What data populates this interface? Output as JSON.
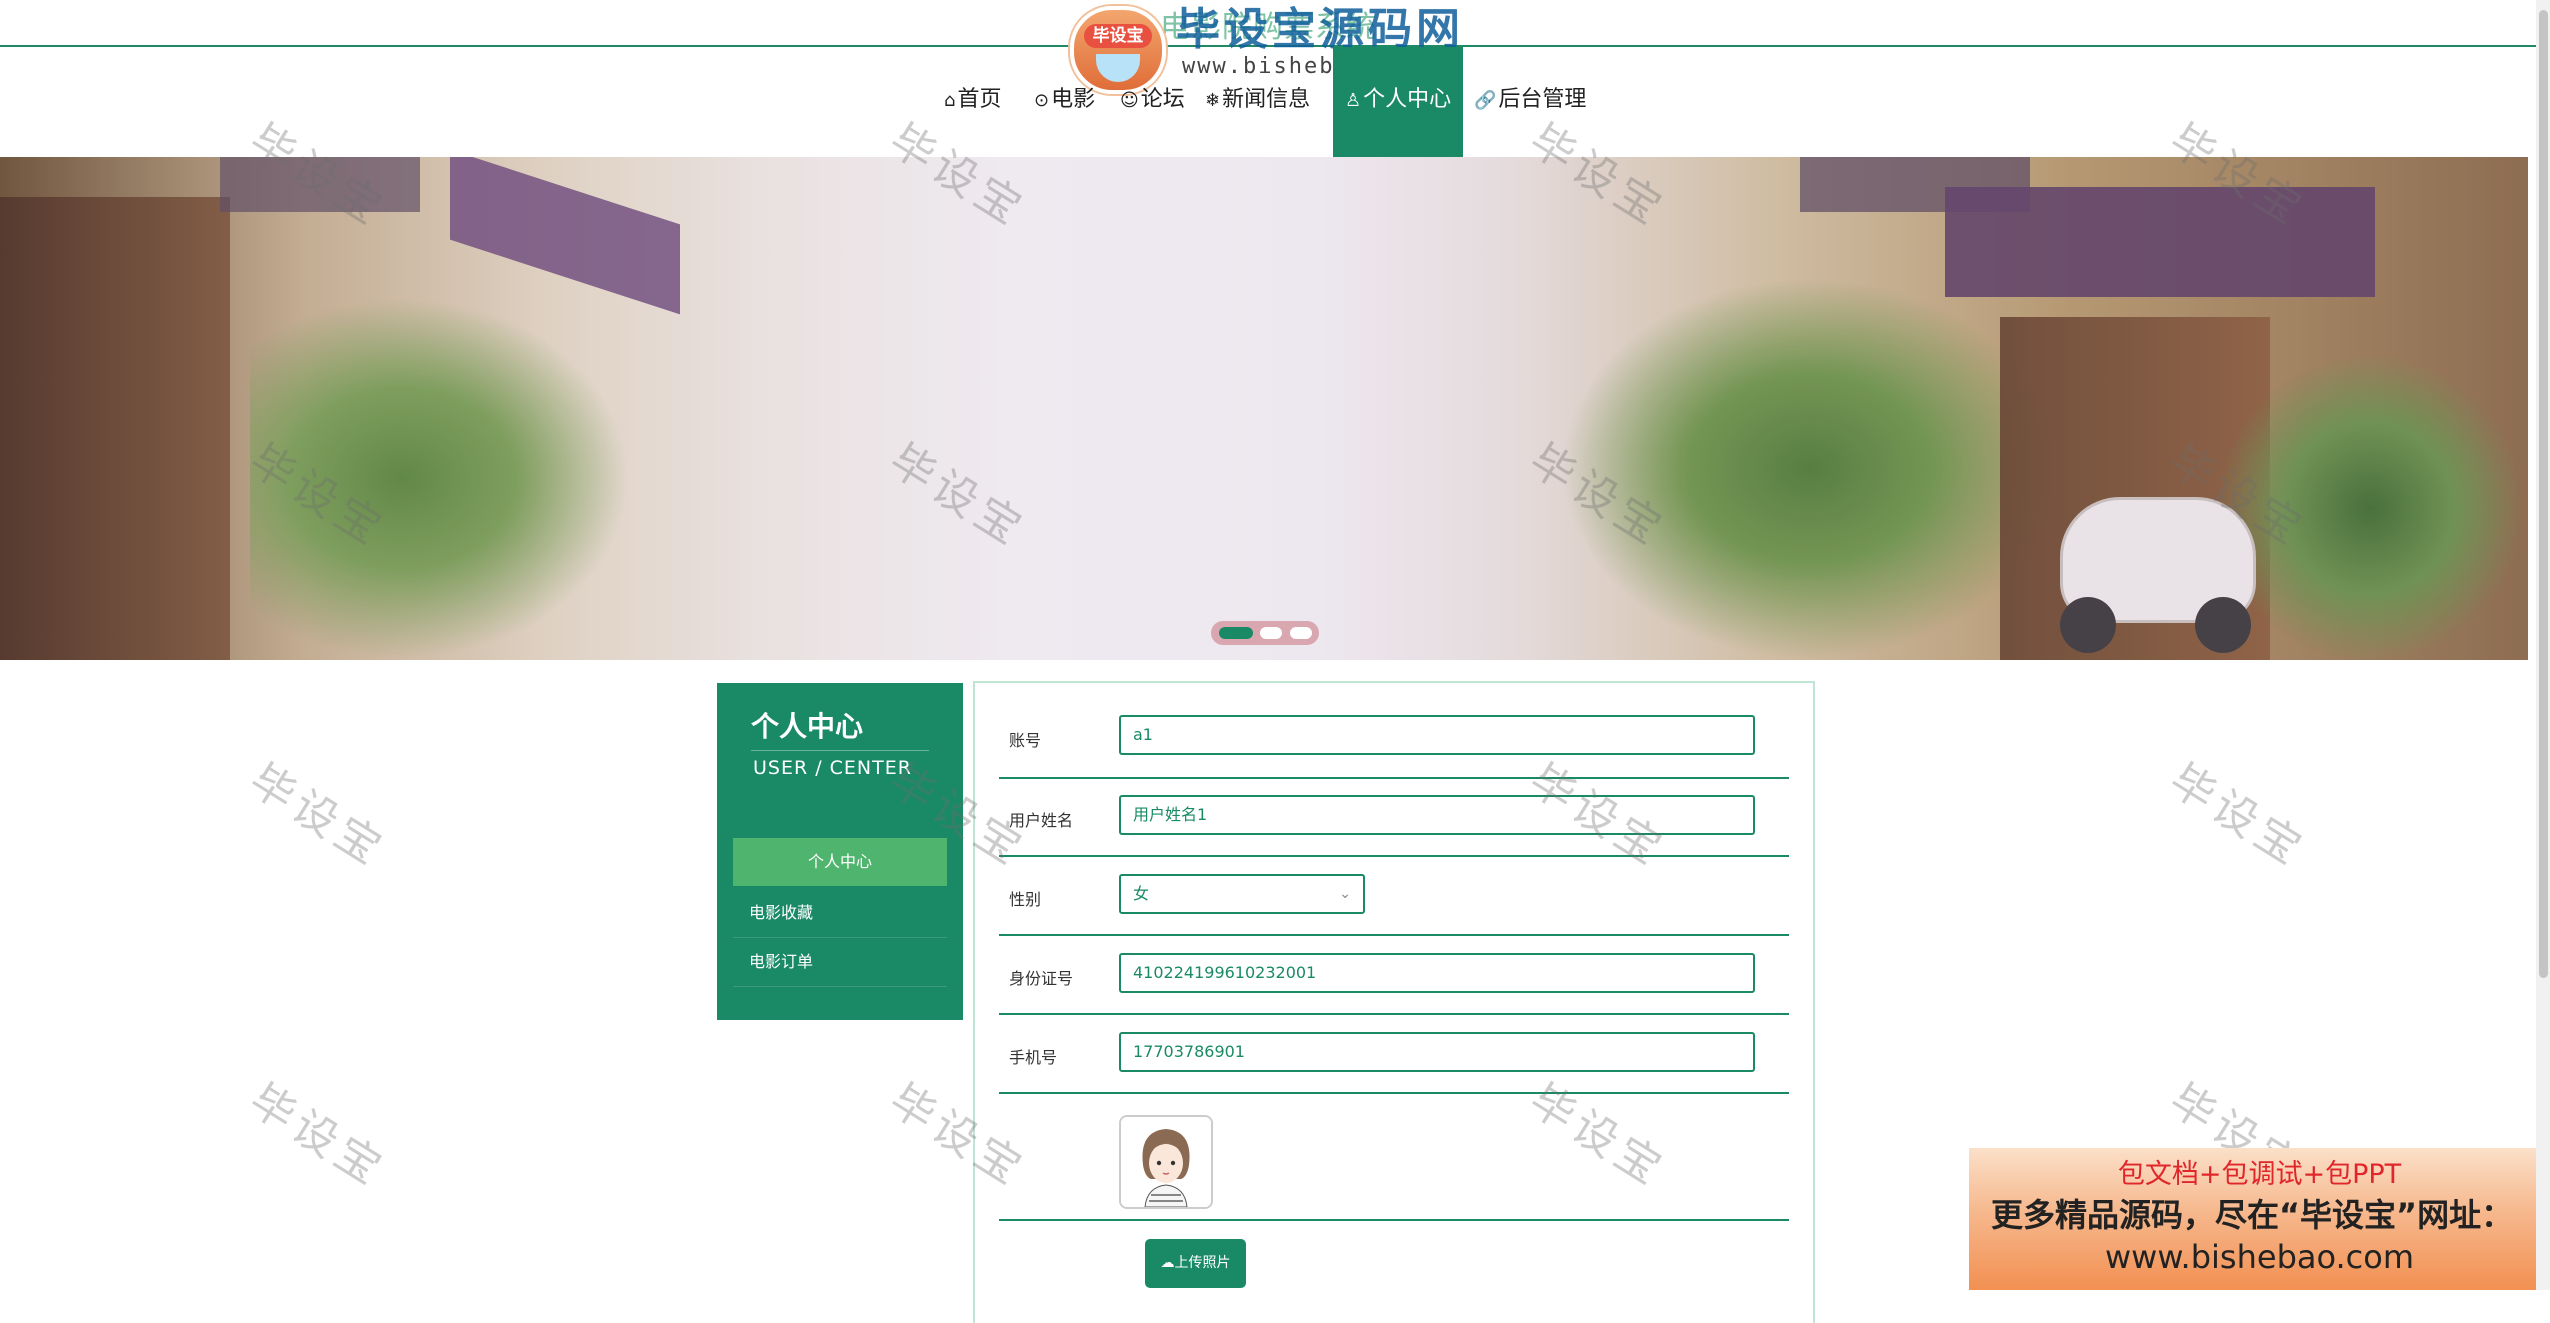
{
  "site": {
    "title": "电影院购票系统"
  },
  "watermark_logo": {
    "badge": "毕设宝",
    "main": "毕设宝源码网",
    "url": "www.bishebao.com"
  },
  "nav": {
    "items": [
      {
        "icon": "home-icon",
        "glyph": "⌂",
        "label": "首页"
      },
      {
        "icon": "film-icon",
        "glyph": "⊙",
        "label": "电影"
      },
      {
        "icon": "forum-icon",
        "glyph": "☺",
        "label": "论坛"
      },
      {
        "icon": "news-icon",
        "glyph": "❄",
        "label": "新闻信息"
      },
      {
        "icon": "user-icon",
        "glyph": "♙",
        "label": "个人中心",
        "active": true
      },
      {
        "icon": "link-icon",
        "glyph": "🔗",
        "label": "后台管理"
      }
    ]
  },
  "banner": {
    "slides": 3,
    "active_slide": 1
  },
  "side": {
    "title": "个人中心",
    "subtitle": "USER / CENTER",
    "items": [
      {
        "label": "个人中心",
        "active": true
      },
      {
        "label": "电影收藏"
      },
      {
        "label": "电影订单"
      }
    ]
  },
  "form": {
    "account_label": "账号",
    "account_value": "a1",
    "name_label": "用户姓名",
    "name_value": "用户姓名1",
    "gender_label": "性别",
    "gender_value": "女",
    "idcard_label": "身份证号",
    "idcard_value": "410224199610232001",
    "phone_label": "手机号",
    "phone_value": "17703786901",
    "upload_label": "上传照片"
  },
  "watermark_text": "毕设宝",
  "ad": {
    "line1": "包文档+包调试+包PPT",
    "line2": "更多精品源码，尽在“毕设宝”网址：",
    "line3": "www.bishebao.com"
  },
  "colors": {
    "primary": "#1a8a66",
    "active_menu": "#4fb46d",
    "ad_red": "#e0262b"
  }
}
